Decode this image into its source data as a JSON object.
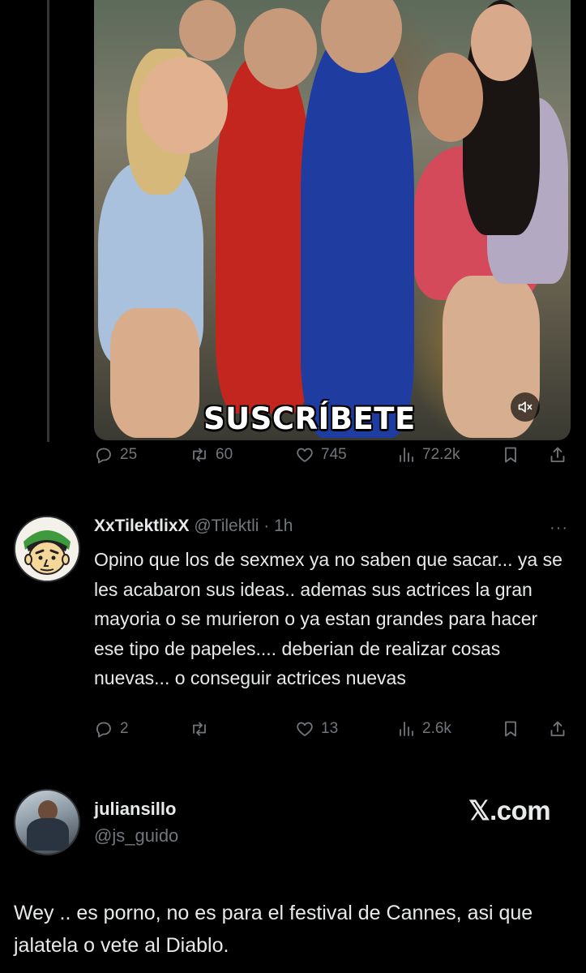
{
  "video": {
    "caption": "SUSCRÍBETE",
    "mute_icon": "speaker-muted-icon"
  },
  "tweet_actions": {
    "replies": "25",
    "reposts": "60",
    "likes": "745",
    "views": "72.2k"
  },
  "reply": {
    "display_name": "XxTilektlixX",
    "handle": "@Tilektli",
    "separator": " · ",
    "time": "1h",
    "more": "···",
    "text": "Opino que los de sexmex ya no saben que sacar... ya se les acabaron sus ideas.. ademas sus actrices la gran mayoria o se murieron o ya estan grandes para hacer ese tipo de papeles.... deberian de realizar cosas nuevas... o conseguir actrices nuevas",
    "actions": {
      "replies": "2",
      "reposts": "",
      "likes": "13",
      "views": "2.6k"
    }
  },
  "card": {
    "display_name": "juliansillo",
    "handle": "@js_guido",
    "source": "𝕏.com",
    "text": "Wey .. es porno, no es para el festival de Cannes, asi que jalatela o vete al Diablo."
  },
  "icons": [
    "reply-icon",
    "repost-icon",
    "like-icon",
    "views-icon",
    "bookmark-icon",
    "share-icon",
    "more-icon"
  ]
}
